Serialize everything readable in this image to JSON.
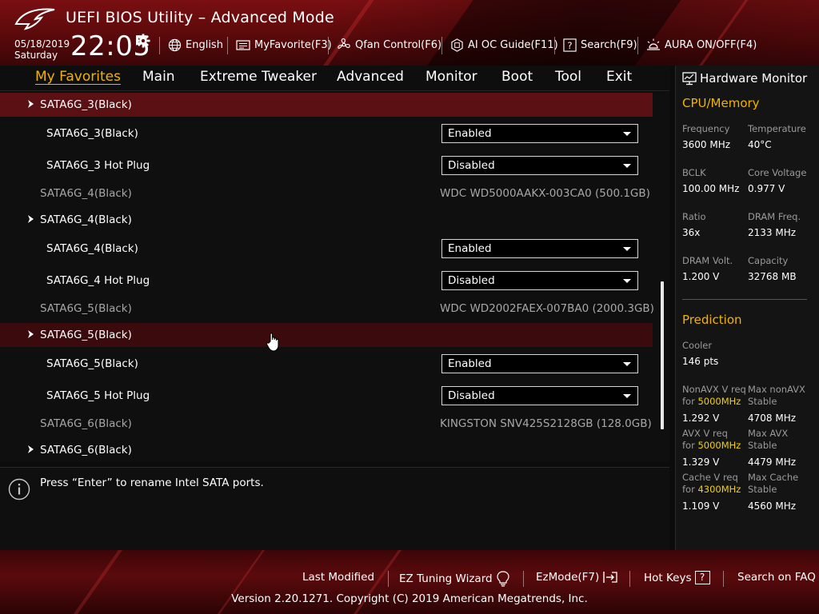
{
  "header": {
    "title": "UEFI BIOS Utility – Advanced Mode",
    "date": "05/18/2019",
    "day": "Saturday",
    "time": "22:05",
    "tools": {
      "language": "English",
      "myfavorite": "MyFavorite(F3)",
      "qfan": "Qfan Control(F6)",
      "aioc": "AI OC Guide(F11)",
      "search": "Search(F9)",
      "aura": "AURA ON/OFF(F4)"
    }
  },
  "tabs": [
    "My Favorites",
    "Main",
    "Extreme Tweaker",
    "Advanced",
    "Monitor",
    "Boot",
    "Tool",
    "Exit"
  ],
  "active_tab": "My Favorites",
  "rows": [
    {
      "type": "section",
      "label": "SATA6G_3(Black)",
      "highlight": true
    },
    {
      "type": "sub",
      "label": "SATA6G_3(Black)",
      "value": "Enabled"
    },
    {
      "type": "sub",
      "label": "SATA6G_3 Hot Plug",
      "value": "Disabled"
    },
    {
      "type": "info",
      "label": "SATA6G_4(Black)",
      "value": "WDC WD5000AAKX-003CA0 (500.1GB)"
    },
    {
      "type": "section",
      "label": "SATA6G_4(Black)",
      "highlight": false
    },
    {
      "type": "sub",
      "label": "SATA6G_4(Black)",
      "value": "Enabled"
    },
    {
      "type": "sub",
      "label": "SATA6G_4 Hot Plug",
      "value": "Disabled"
    },
    {
      "type": "info",
      "label": "SATA6G_5(Black)",
      "value": "WDC WD2002FAEX-007BA0 (2000.3GB)"
    },
    {
      "type": "section",
      "label": "SATA6G_5(Black)",
      "highlight": true
    },
    {
      "type": "sub",
      "label": "SATA6G_5(Black)",
      "value": "Enabled"
    },
    {
      "type": "sub",
      "label": "SATA6G_5 Hot Plug",
      "value": "Disabled"
    },
    {
      "type": "info",
      "label": "SATA6G_6(Black)",
      "value": "KINGSTON SNV425S2128GB (128.0GB)"
    },
    {
      "type": "section",
      "label": "SATA6G_6(Black)",
      "highlight": false
    }
  ],
  "help_text": "Press “Enter” to rename Intel SATA ports.",
  "monitor": {
    "title": "Hardware Monitor",
    "cpu_section": "CPU/Memory",
    "cpu": {
      "frequency_label": "Frequency",
      "frequency": "3600 MHz",
      "temperature_label": "Temperature",
      "temperature": "40°C",
      "bclk_label": "BCLK",
      "bclk": "100.00 MHz",
      "core_voltage_label": "Core Voltage",
      "core_voltage": "0.977 V",
      "ratio_label": "Ratio",
      "ratio": "36x",
      "dram_freq_label": "DRAM Freq.",
      "dram_freq": "2133 MHz",
      "dram_volt_label": "DRAM Volt.",
      "dram_volt": "1.200 V",
      "capacity_label": "Capacity",
      "capacity": "32768 MB"
    },
    "prediction_section": "Prediction",
    "prediction": {
      "cooler_label": "Cooler",
      "cooler": "146 pts",
      "nonavx_label_1": "NonAVX V req",
      "nonavx_for": "for ",
      "nonavx_freq": "5000MHz",
      "nonavx_v": "1.292 V",
      "max_nonavx_label_1": "Max nonAVX",
      "max_nonavx_label_2": "Stable",
      "max_nonavx": "4708 MHz",
      "avx_label_1": "AVX V req",
      "avx_for": "for ",
      "avx_freq": "5000MHz",
      "avx_v": "1.329 V",
      "max_avx_label_1": "Max AVX",
      "max_avx_label_2": "Stable",
      "max_avx": "4479 MHz",
      "cache_label_1": "Cache V req",
      "cache_for": "for ",
      "cache_freq": "4300MHz",
      "cache_v": "1.109 V",
      "max_cache_label_1": "Max Cache",
      "max_cache_label_2": "Stable",
      "max_cache": "4560 MHz"
    }
  },
  "footer": {
    "last_modified": "Last Modified",
    "ez_tuning": "EZ Tuning Wizard",
    "ezmode": "EzMode(F7)",
    "hotkeys": "Hot Keys",
    "hotkeys_key": "?",
    "search_faq": "Search on FAQ",
    "copyright": "Version 2.20.1271. Copyright (C) 2019 American Megatrends, Inc."
  },
  "colors": {
    "accent": "#f0b400",
    "highlight_row": "#5b1013",
    "header_red": "#7a0f12"
  }
}
